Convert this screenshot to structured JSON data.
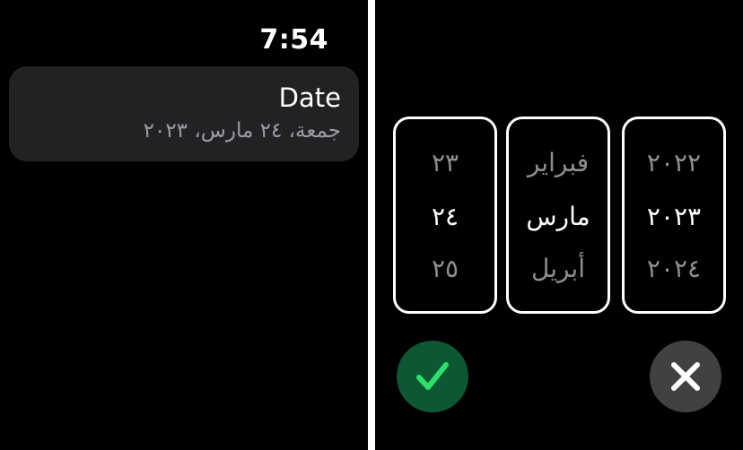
{
  "status": {
    "time": "7:54"
  },
  "date_cell": {
    "title": "Date",
    "value": "جمعة، ٢٤ مارس، ٢٠٢٣"
  },
  "picker": {
    "day": {
      "above": "٢٣",
      "selected": "٢٤",
      "below": "٢٥"
    },
    "month": {
      "above": "فبراير",
      "selected": "مارس",
      "below": "أبريل"
    },
    "year": {
      "above": "٢٠٢٢",
      "selected": "٢٠٢٣",
      "below": "٢٠٢٤"
    }
  },
  "buttons": {
    "confirm_icon": "checkmark-icon",
    "cancel_icon": "xmark-icon",
    "confirm_color": "#0d5733",
    "check_color": "#2ee06c",
    "cancel_color": "#414143"
  }
}
